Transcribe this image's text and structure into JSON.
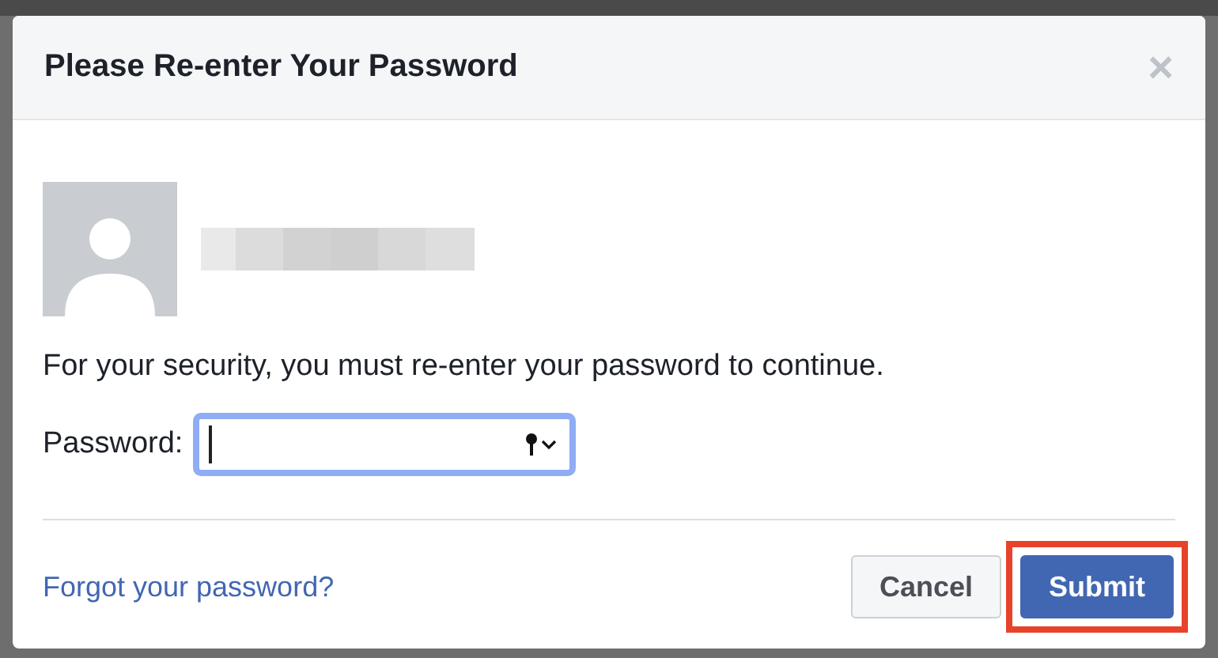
{
  "dialog": {
    "title": "Please Re-enter Your Password",
    "close": "×"
  },
  "account": {
    "name_blurred": true
  },
  "message": "For your security, you must re-enter your password to continue.",
  "password": {
    "label": "Password:",
    "focused": true
  },
  "footer": {
    "link": "Forgot your password?",
    "buttons": [
      {
        "label": "Cancel",
        "kind": "secondary",
        "highlighted": false
      },
      {
        "label": "Submit",
        "kind": "primary",
        "highlighted": true
      }
    ]
  }
}
